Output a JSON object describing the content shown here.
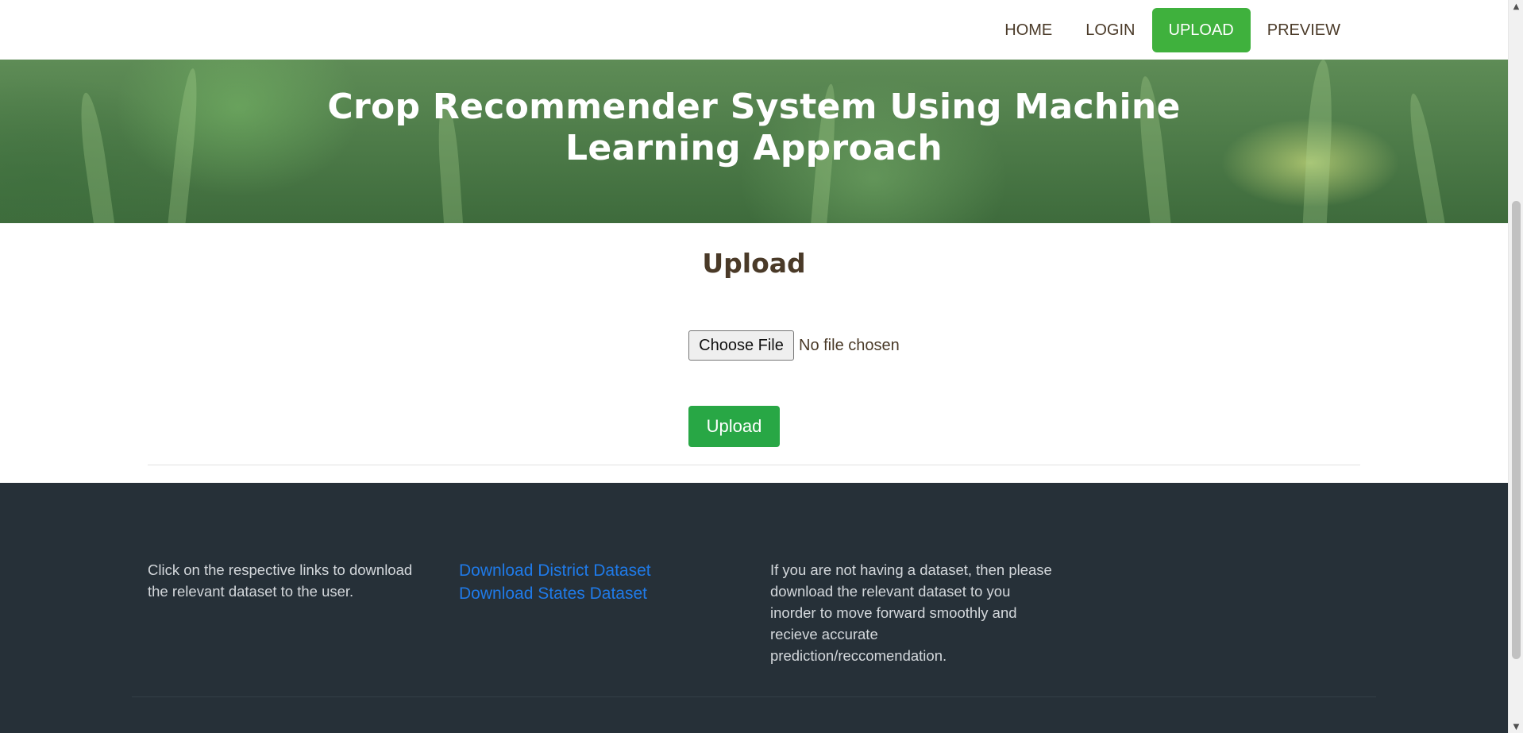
{
  "nav": {
    "items": [
      {
        "label": "HOME",
        "active": false
      },
      {
        "label": "LOGIN",
        "active": false
      },
      {
        "label": "UPLOAD",
        "active": true
      },
      {
        "label": "PREVIEW",
        "active": false
      }
    ]
  },
  "hero": {
    "title": "Crop Recommender System Using Machine Learning Approach"
  },
  "main": {
    "heading": "Upload",
    "file_input": {
      "button_label": "Choose File",
      "status": "No file chosen"
    },
    "submit_label": "Upload"
  },
  "footer": {
    "left_text": "Click on the respective links to download the relevant dataset to the user.",
    "links": [
      {
        "label": "Download District Dataset"
      },
      {
        "label": "Download States Dataset"
      }
    ],
    "right_text": "If you are not having a dataset, then please download the relevant dataset to you inorder to move forward smoothly and recieve accurate prediction/reccomendation."
  },
  "colors": {
    "accent": "#28a745",
    "nav_active": "#3fb13d",
    "text": "#4a3a28",
    "footer_bg": "#263038",
    "link": "#1f7ae8"
  },
  "icons": {
    "scroll_up": "triangle-up-icon",
    "scroll_down": "triangle-down-icon"
  }
}
